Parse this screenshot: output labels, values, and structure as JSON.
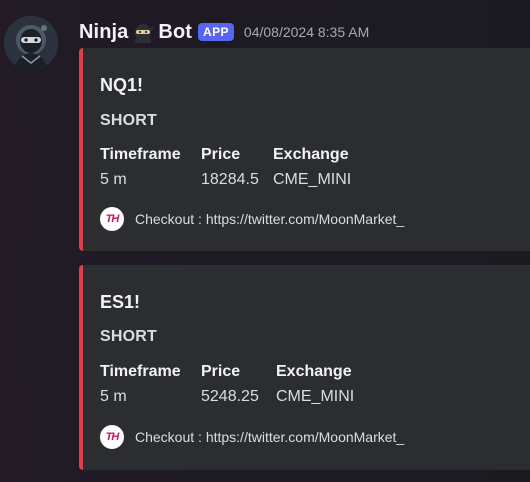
{
  "message": {
    "author": {
      "name_prefix": "Ninja",
      "name_suffix": "Bot",
      "emoji": "ninja-emoji",
      "badge": "APP",
      "avatar": "ninja-avatar"
    },
    "timestamp": "04/08/2024 8:35 AM",
    "colors": {
      "embed_border": "#e03e4a",
      "embed_bg": "#2b2d31",
      "badge_bg": "#5865f2"
    },
    "embeds": [
      {
        "title": "NQ1!",
        "description": "SHORT",
        "fields": [
          {
            "name": "Timeframe",
            "value": "5 m"
          },
          {
            "name": "Price",
            "value": "18284.5"
          },
          {
            "name": "Exchange",
            "value": "CME_MINI"
          }
        ],
        "footer": {
          "icon_text": "TH",
          "text": "Checkout : https://twitter.com/MoonMarket_"
        }
      },
      {
        "title": "ES1!",
        "description": "SHORT",
        "fields": [
          {
            "name": "Timeframe",
            "value": "5 m"
          },
          {
            "name": "Price",
            "value": "5248.25"
          },
          {
            "name": "Exchange",
            "value": "CME_MINI"
          }
        ],
        "footer": {
          "icon_text": "TH",
          "text": "Checkout : https://twitter.com/MoonMarket_"
        }
      }
    ]
  }
}
